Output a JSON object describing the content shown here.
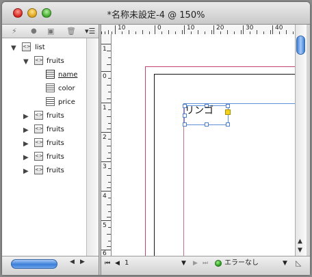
{
  "window": {
    "title": "*名称未設定-4 @ 150%"
  },
  "tree_toolbar": {
    "icons": [
      "tag-add-icon",
      "circle-icon",
      "box-icon",
      "trash-icon",
      "list-menu-icon"
    ]
  },
  "tree": {
    "root": {
      "label": "list",
      "expanded": true
    },
    "fruits_expanded": {
      "label": "fruits"
    },
    "fields": [
      {
        "label": "name",
        "selected": true
      },
      {
        "label": "color"
      },
      {
        "label": "price"
      }
    ],
    "collapsed": [
      {
        "label": "fruits"
      },
      {
        "label": "fruits"
      },
      {
        "label": "fruits"
      },
      {
        "label": "fruits"
      },
      {
        "label": "fruits"
      }
    ]
  },
  "ruler": {
    "top": [
      "10",
      "0",
      "10",
      "20",
      "30",
      "40"
    ],
    "left": [
      "1",
      "0",
      "1",
      "2",
      "3",
      "4",
      "5",
      "6"
    ]
  },
  "canvas": {
    "frame_text": "リンゴ"
  },
  "status": {
    "page": "1",
    "error_text": "エラーなし"
  },
  "colors": {
    "accent": "#3b7fd9",
    "margin_guide": "#c0446a",
    "frame_border": "#5b8fd8",
    "handle_fill": "#f2d21a"
  }
}
